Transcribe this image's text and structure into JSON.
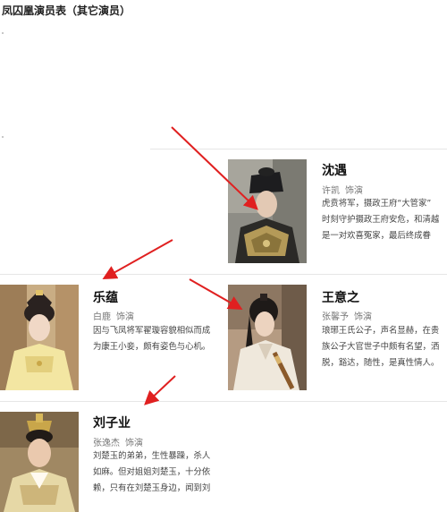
{
  "page": {
    "title": "凤囚凰演员表（其它演员）"
  },
  "colors": {
    "arrow": "#e02020",
    "divider": "#e6e6e6",
    "name_text": "#111111",
    "actor_text": "#777777",
    "desc_text": "#444444"
  },
  "cast": [
    {
      "id": "shenyu",
      "character": "沈遇",
      "actor": "许凯",
      "role_tag": "饰演",
      "desc_lines": [
        "虎贲将军，摄政王府“大管家”",
        "时刻守护摄政王府安危，和清越",
        "是一对欢喜冤家，最后终成眷"
      ]
    },
    {
      "id": "leyun",
      "character": "乐蕴",
      "actor": "白鹿",
      "role_tag": "饰演",
      "desc_lines": [
        "因与飞凤将军翟璇容貌相似而成",
        "为康王小妾，颇有姿色与心机。"
      ]
    },
    {
      "id": "wangyizhi",
      "character": "王意之",
      "actor": "张馨予",
      "role_tag": "饰演",
      "desc_lines": [
        "琅琊王氏公子，声名显赫，在贵",
        "族公子大官世子中颇有名望，洒",
        "脱，豁达，随性，是真性情人。"
      ]
    },
    {
      "id": "liuziye",
      "character": "刘子业",
      "actor": "张逸杰",
      "role_tag": "饰演",
      "desc_lines": [
        "刘楚玉的弟弟，生性暴躁，杀人",
        "如麻。但对姐姐刘楚玉，十分依",
        "赖，只有在刘楚玉身边，闻到刘"
      ]
    }
  ]
}
